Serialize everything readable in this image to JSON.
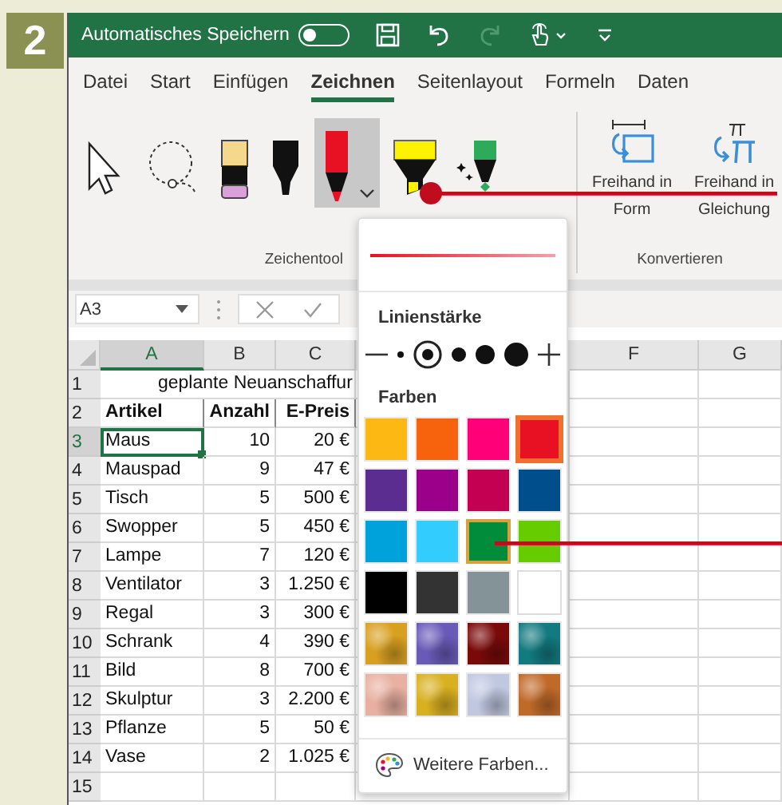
{
  "step": "2",
  "title_bar": {
    "autosave_label": "Automatisches Speichern",
    "autosave_on": false
  },
  "tabs": [
    {
      "label": "Datei",
      "selected": false
    },
    {
      "label": "Start",
      "selected": false
    },
    {
      "label": "Einfügen",
      "selected": false
    },
    {
      "label": "Zeichnen",
      "selected": true
    },
    {
      "label": "Seitenlayout",
      "selected": false
    },
    {
      "label": "Formeln",
      "selected": false
    },
    {
      "label": "Daten",
      "selected": false
    }
  ],
  "ribbon": {
    "tools": [
      {
        "kind": "pointer",
        "selected": false
      },
      {
        "kind": "lasso",
        "selected": false
      },
      {
        "kind": "pencil",
        "selected": false
      },
      {
        "kind": "black-pen",
        "selected": false
      },
      {
        "kind": "red-pen",
        "selected": true
      },
      {
        "kind": "highlighter",
        "selected": false
      },
      {
        "kind": "action-pen",
        "selected": false
      }
    ],
    "tools_group_label": "Zeichentool",
    "convert_buttons": [
      {
        "kind": "shape",
        "label": "Freihand in Form"
      },
      {
        "kind": "math",
        "label": "Freihand in Gleichung"
      }
    ],
    "convert_group_label": "Konvertieren"
  },
  "formula_bar": {
    "name_box": "A3"
  },
  "sheet": {
    "columns": [
      {
        "label": "A",
        "selected": true
      },
      {
        "label": "B",
        "selected": false
      },
      {
        "label": "C",
        "selected": false
      },
      {
        "label": "F",
        "selected": false
      },
      {
        "label": "G",
        "selected": false
      }
    ],
    "title_row": {
      "num": "1",
      "text": "geplante Neuanschaffur"
    },
    "header_row": {
      "num": "2",
      "cells": [
        "Artikel",
        "Anzahl",
        "E-Preis"
      ]
    },
    "rows": [
      {
        "num": "3",
        "cells": [
          "Maus",
          "10",
          "20 €"
        ],
        "selected": true
      },
      {
        "num": "4",
        "cells": [
          "Mauspad",
          "9",
          "47 €"
        ],
        "selected": false
      },
      {
        "num": "5",
        "cells": [
          "Tisch",
          "5",
          "500 €"
        ],
        "selected": false
      },
      {
        "num": "6",
        "cells": [
          "Swopper",
          "5",
          "450 €"
        ],
        "selected": false
      },
      {
        "num": "7",
        "cells": [
          "Lampe",
          "7",
          "120 €"
        ],
        "selected": false
      },
      {
        "num": "8",
        "cells": [
          "Ventilator",
          "3",
          "1.250 €"
        ],
        "selected": false
      },
      {
        "num": "9",
        "cells": [
          "Regal",
          "3",
          "300 €"
        ],
        "selected": false
      },
      {
        "num": "10",
        "cells": [
          "Schrank",
          "4",
          "390 €"
        ],
        "selected": false
      },
      {
        "num": "11",
        "cells": [
          "Bild",
          "8",
          "700 €"
        ],
        "selected": false
      },
      {
        "num": "12",
        "cells": [
          "Skulptur",
          "3",
          "2.200 €"
        ],
        "selected": false
      },
      {
        "num": "13",
        "cells": [
          "Pflanze",
          "5",
          "50 €"
        ],
        "selected": false
      },
      {
        "num": "14",
        "cells": [
          "Vase",
          "2",
          "1.025 €"
        ],
        "selected": false
      },
      {
        "num": "15",
        "cells": [
          "",
          "",
          ""
        ],
        "selected": false
      }
    ]
  },
  "pen_menu": {
    "thickness_label": "Linienstärke",
    "thickness": [
      {
        "kind": "minus"
      },
      {
        "kind": "dot",
        "selected": false
      },
      {
        "kind": "dot",
        "selected": true
      },
      {
        "kind": "dot",
        "selected": false
      },
      {
        "kind": "dot",
        "selected": false
      },
      {
        "kind": "dot",
        "selected": false
      },
      {
        "kind": "plus"
      }
    ],
    "colors_label": "Farben",
    "swatches": [
      {
        "kind": "solid",
        "color": "#fdb813",
        "selected": false,
        "highlighted": false
      },
      {
        "kind": "solid",
        "color": "#f7630c",
        "selected": false,
        "highlighted": false
      },
      {
        "kind": "solid",
        "color": "#ff0078",
        "selected": false,
        "highlighted": false
      },
      {
        "kind": "solid",
        "color": "#e81123",
        "selected": true,
        "highlighted": false
      },
      {
        "kind": "solid",
        "color": "#5c2d91",
        "selected": false,
        "highlighted": false
      },
      {
        "kind": "solid",
        "color": "#9a0089",
        "selected": false,
        "highlighted": false
      },
      {
        "kind": "solid",
        "color": "#c30052",
        "selected": false,
        "highlighted": false
      },
      {
        "kind": "solid",
        "color": "#004e8c",
        "selected": false,
        "highlighted": false
      },
      {
        "kind": "solid",
        "color": "#00a2db",
        "selected": false,
        "highlighted": false
      },
      {
        "kind": "solid",
        "color": "#33ccff",
        "selected": false,
        "highlighted": false
      },
      {
        "kind": "solid",
        "color": "#008c3a",
        "selected": false,
        "highlighted": true
      },
      {
        "kind": "solid",
        "color": "#66cc00",
        "selected": false,
        "highlighted": false
      },
      {
        "kind": "solid",
        "color": "#000000",
        "selected": false,
        "highlighted": false
      },
      {
        "kind": "solid",
        "color": "#333333",
        "selected": false,
        "highlighted": false
      },
      {
        "kind": "solid",
        "color": "#849398",
        "selected": false,
        "highlighted": false
      },
      {
        "kind": "solid",
        "color": "#ffffff",
        "selected": false,
        "highlighted": false
      },
      {
        "kind": "texture",
        "color": "#d8a020",
        "selected": false,
        "highlighted": false
      },
      {
        "kind": "texture",
        "color": "#6a5ab8",
        "selected": false,
        "highlighted": false
      },
      {
        "kind": "texture",
        "color": "#7a0a0a",
        "selected": false,
        "highlighted": false
      },
      {
        "kind": "texture",
        "color": "#127a80",
        "selected": false,
        "highlighted": false
      },
      {
        "kind": "texture",
        "color": "#e8b0a0",
        "selected": false,
        "highlighted": false
      },
      {
        "kind": "texture",
        "color": "#d8b020",
        "selected": false,
        "highlighted": false
      },
      {
        "kind": "texture",
        "color": "#c0c8e0",
        "selected": false,
        "highlighted": false
      },
      {
        "kind": "texture",
        "color": "#c06a2a",
        "selected": false,
        "highlighted": false
      }
    ],
    "more_colors": "Weitere Farben..."
  }
}
